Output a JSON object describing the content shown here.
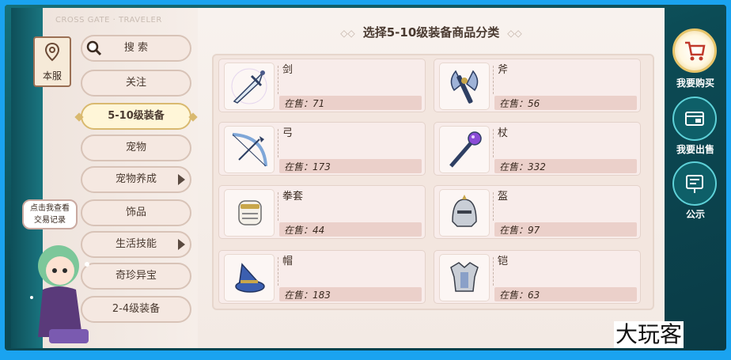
{
  "left": {
    "brand_text": "CROSS GATE · TRAVELER",
    "server_tag": "本服",
    "chat_bubble": [
      "点击我查看",
      "交易记录"
    ],
    "nav": [
      {
        "label": "搜 索"
      },
      {
        "label": "关注"
      },
      {
        "label": "5-10级装备",
        "active": true
      },
      {
        "label": "宠物"
      },
      {
        "label": "宠物养成",
        "has_arrow": true
      },
      {
        "label": "饰品"
      },
      {
        "label": "生活技能",
        "has_arrow": true
      },
      {
        "label": "奇珍异宝"
      },
      {
        "label": "2-4级装备"
      }
    ]
  },
  "main": {
    "title": "选择5-10级装备商品分类",
    "items": [
      {
        "name": "剑",
        "count": "在售：71",
        "icon": "sword-icon"
      },
      {
        "name": "斧",
        "count": "在售：56",
        "icon": "axe-icon"
      },
      {
        "name": "弓",
        "count": "在售：173",
        "icon": "bow-icon"
      },
      {
        "name": "杖",
        "count": "在售：332",
        "icon": "staff-icon"
      },
      {
        "name": "拳套",
        "count": "在售：44",
        "icon": "gauntlet-icon"
      },
      {
        "name": "盔",
        "count": "在售：97",
        "icon": "helmet-icon"
      },
      {
        "name": "帽",
        "count": "在售：183",
        "icon": "hat-icon"
      },
      {
        "name": "铠",
        "count": "在售：63",
        "icon": "armor-icon"
      }
    ]
  },
  "right": {
    "buy_label": "我要购买",
    "sell_label": "我要出售",
    "notice_label": "公示"
  },
  "watermark": "大玩客",
  "colors": {
    "frame": "#1aa3f0",
    "active_nav": "#fff6d8",
    "teal": "#0f5a63"
  }
}
